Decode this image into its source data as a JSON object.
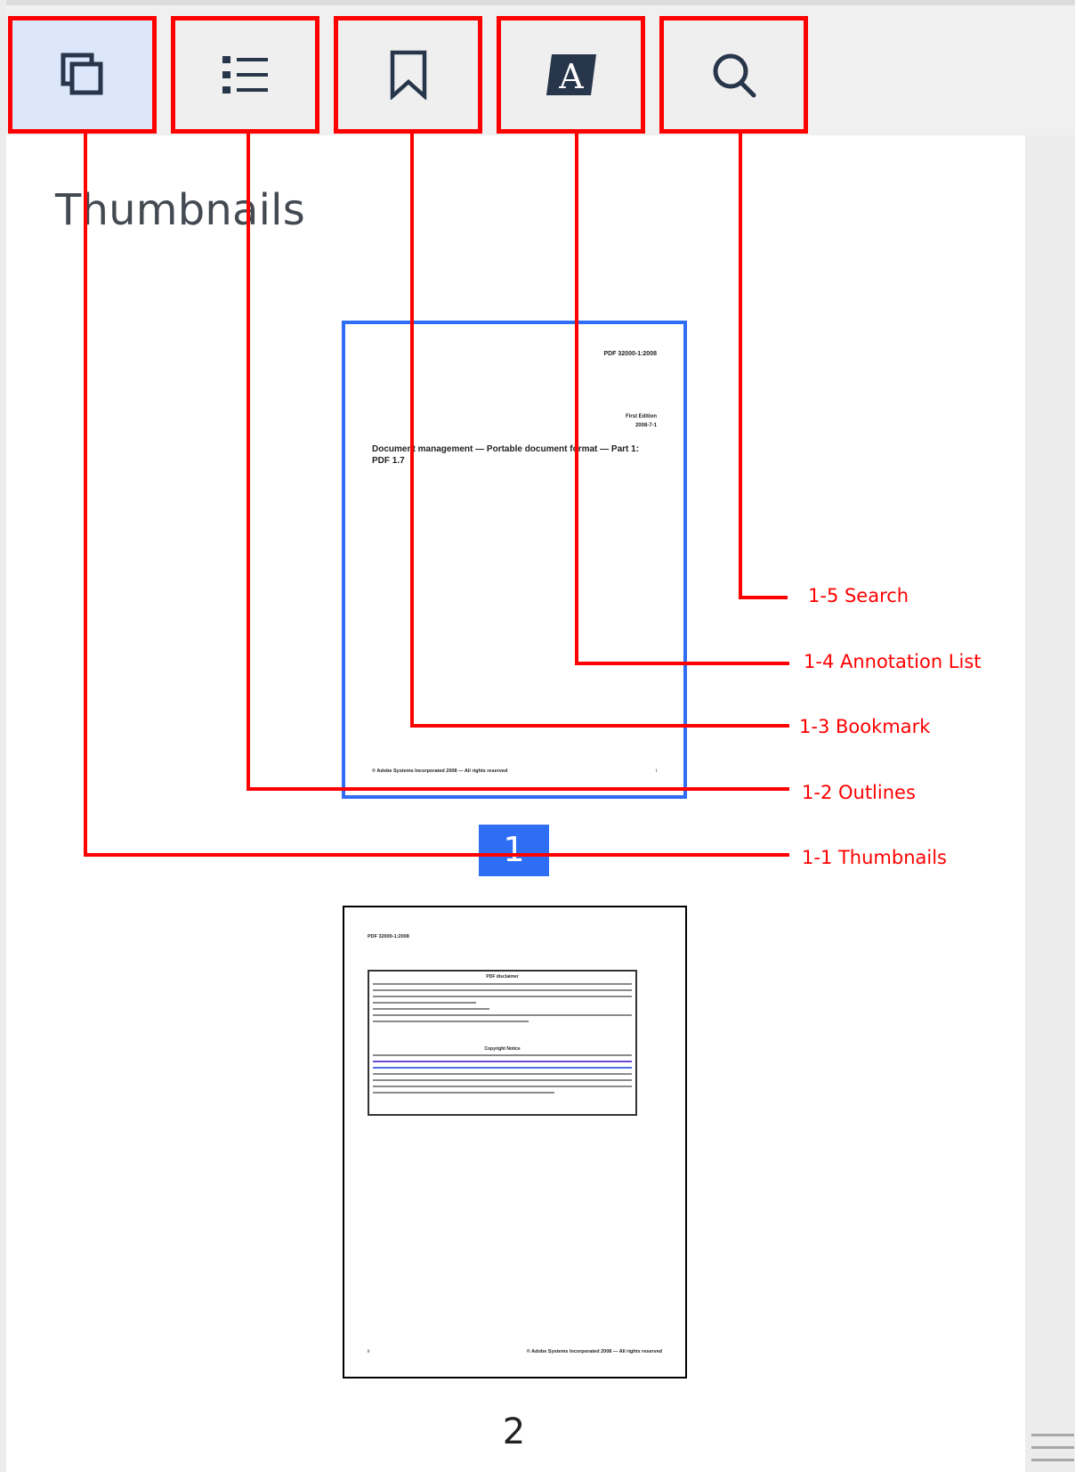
{
  "panel": {
    "title": "Thumbnails"
  },
  "tabs": [
    {
      "id": "thumbnails",
      "icon": "thumbnails-icon",
      "active": true
    },
    {
      "id": "outlines",
      "icon": "list-icon",
      "active": false
    },
    {
      "id": "bookmark",
      "icon": "bookmark-icon",
      "active": false
    },
    {
      "id": "annotation-list",
      "icon": "annotation-icon",
      "active": false
    },
    {
      "id": "search",
      "icon": "search-icon",
      "active": false
    }
  ],
  "thumb1": {
    "header": "PDF 32000-1:2008",
    "edition": "First Edition",
    "date": "2008-7-1",
    "title_line1": "Document management — Portable document format — Part 1:",
    "title_line2": "PDF 1.7",
    "footer": "© Adobe Systems Incorporated 2008 — All rights reserved",
    "footer_page": "i"
  },
  "thumb2": {
    "header": "PDF 32000-1:2008",
    "box_title": "PDF disclaimer",
    "copyright_title": "Copyright Notice",
    "footer_page": "ii",
    "footer": "© Adobe Systems Incorporated 2008 — All rights reserved"
  },
  "pages": {
    "page1": "1",
    "page2": "2"
  },
  "callouts": {
    "search": "1-5 Search",
    "annotation": "1-4 Annotation List",
    "bookmark": "1-3 Bookmark",
    "outlines": "1-2 Outlines",
    "thumbnails": "1-1 Thumbnails"
  },
  "colors": {
    "accent": "#2e6ef4",
    "callout": "#ff0000",
    "active_tab_bg": "#dce7fb"
  }
}
